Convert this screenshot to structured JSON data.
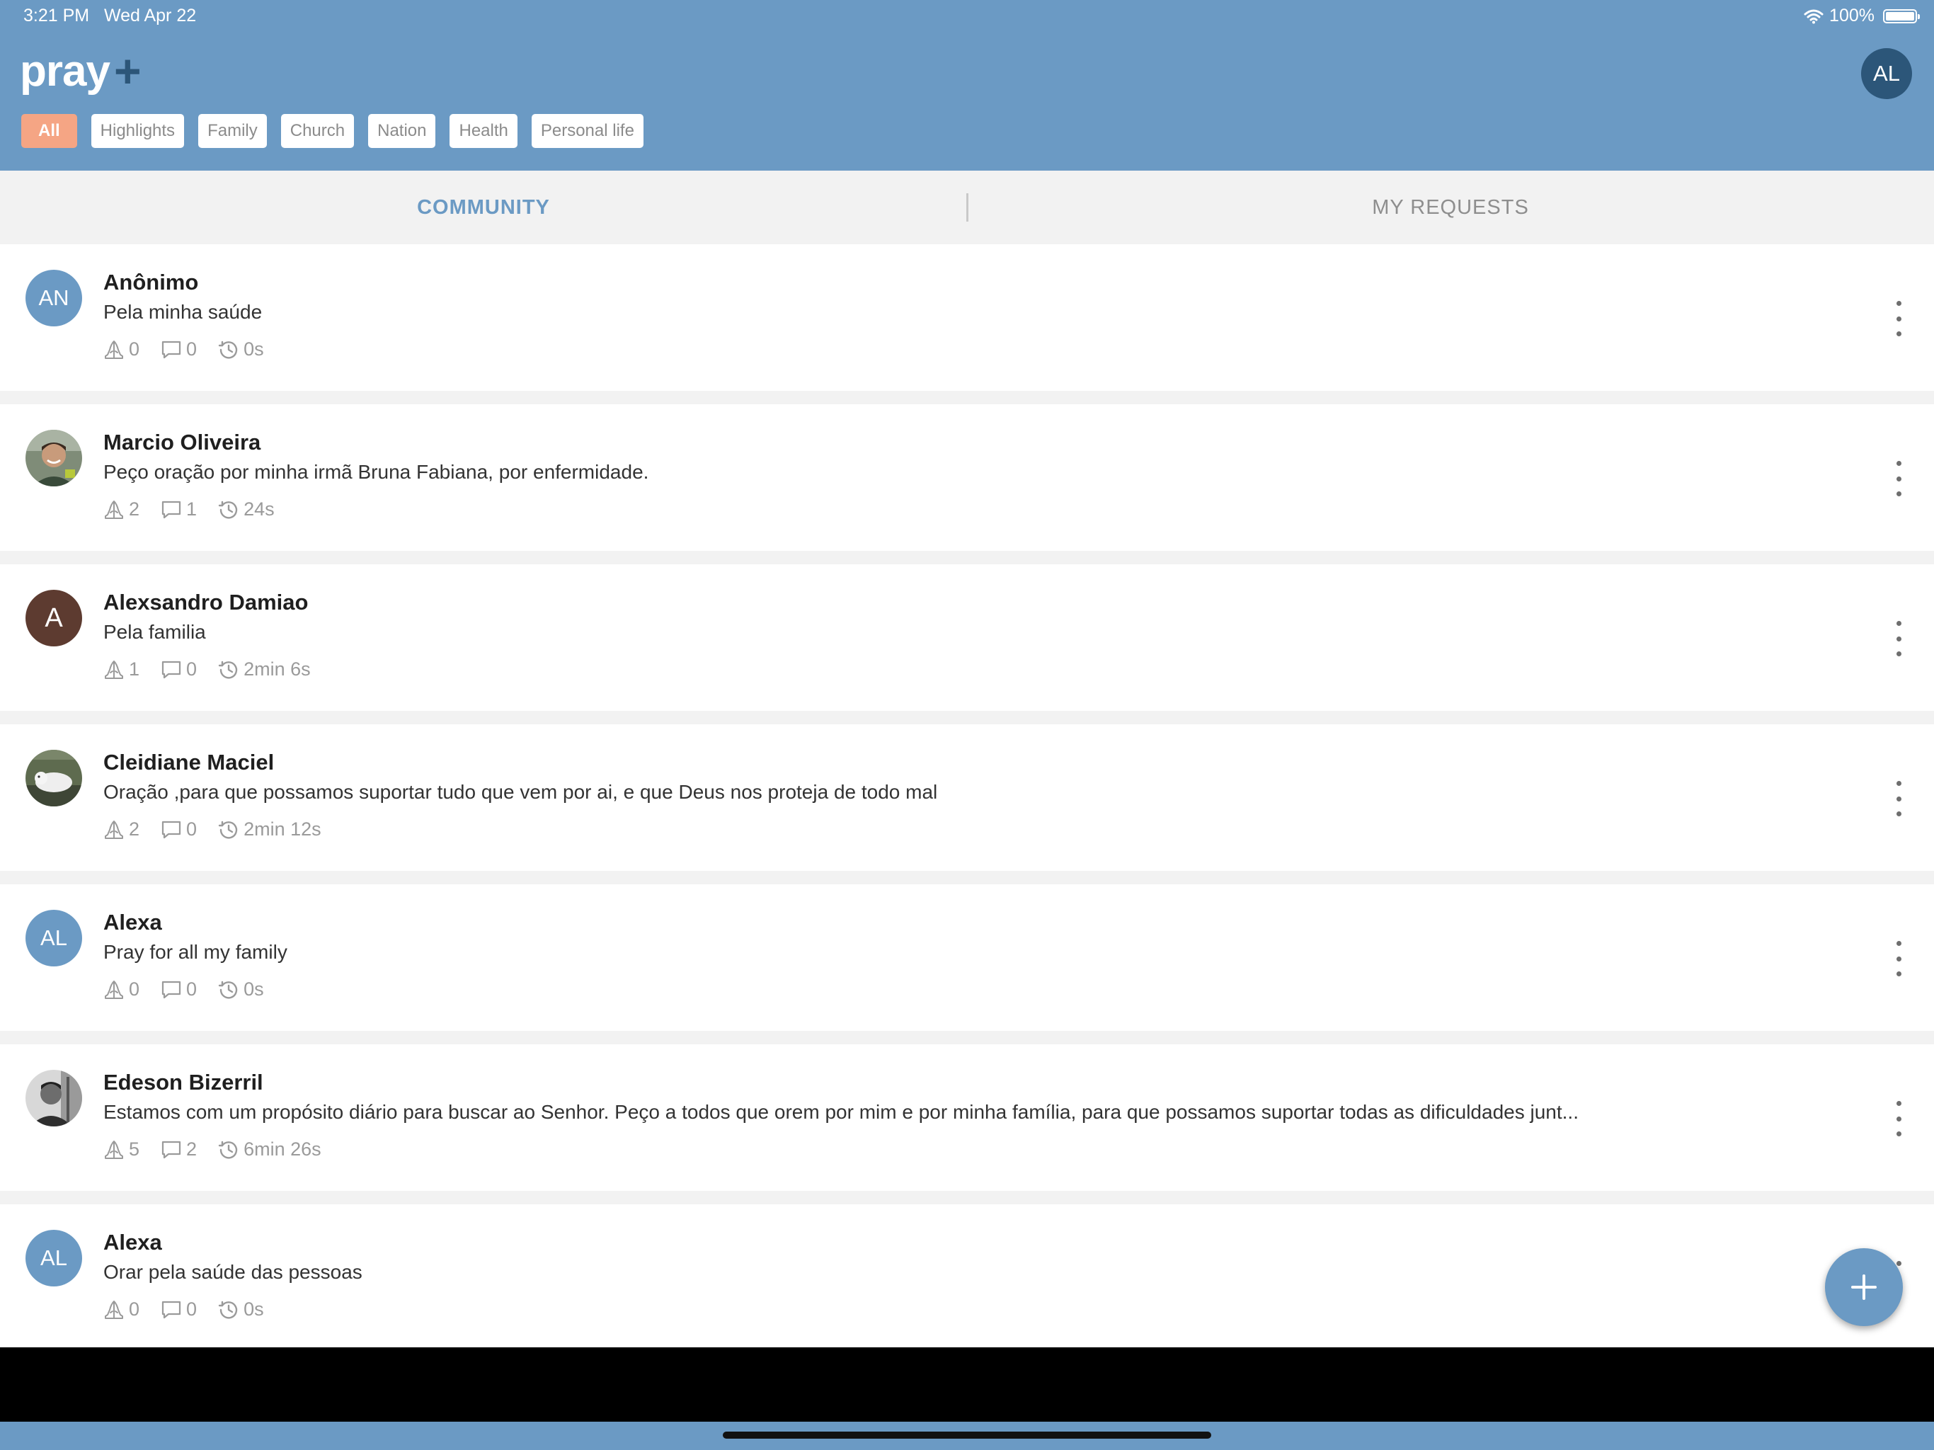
{
  "status_bar": {
    "time": "3:21 PM",
    "date": "Wed Apr 22",
    "battery": "100%"
  },
  "header": {
    "logo_text": "pray",
    "logo_plus": "+",
    "user_initials": "AL"
  },
  "filters": [
    {
      "label": "All",
      "active": true
    },
    {
      "label": "Highlights",
      "active": false
    },
    {
      "label": "Family",
      "active": false
    },
    {
      "label": "Church",
      "active": false
    },
    {
      "label": "Nation",
      "active": false
    },
    {
      "label": "Health",
      "active": false
    },
    {
      "label": "Personal life",
      "active": false
    }
  ],
  "tabs": {
    "community": "COMMUNITY",
    "my_requests": "MY REQUESTS",
    "selected": "community"
  },
  "posts": [
    {
      "name": "Anônimo",
      "initials": "AN",
      "avatar": "initials-blue",
      "text": "Pela minha saúde",
      "prayers": "0",
      "comments": "0",
      "time": "0s"
    },
    {
      "name": "Marcio Oliveira",
      "avatar": "photo-man-smiling",
      "text": "Peço oração por minha irmã Bruna Fabiana,  por enfermidade.",
      "prayers": "2",
      "comments": "1",
      "time": "24s"
    },
    {
      "name": "Alexsandro Damiao",
      "initials": "A",
      "avatar": "initials-brown",
      "text": "Pela familia",
      "prayers": "1",
      "comments": "0",
      "time": "2min 6s"
    },
    {
      "name": "Cleidiane Maciel",
      "avatar": "photo-animal",
      "text": "Oração ,para que possamos suportar tudo que vem por ai, e que Deus nos proteja de todo mal",
      "prayers": "2",
      "comments": "0",
      "time": "2min 12s"
    },
    {
      "name": "Alexa",
      "initials": "AL",
      "avatar": "initials-blue",
      "text": "Pray for all my family",
      "prayers": "0",
      "comments": "0",
      "time": "0s"
    },
    {
      "name": "Edeson Bizerril",
      "avatar": "photo-man-bw",
      "text": "Estamos com um propósito diário para buscar ao Senhor. Peço a todos que orem por mim e por minha família, para que possamos suportar todas as dificuldades junt...",
      "prayers": "5",
      "comments": "2",
      "time": "6min 26s"
    },
    {
      "name": "Alexa",
      "initials": "AL",
      "avatar": "initials-blue",
      "text": "Orar pela saúde das pessoas",
      "prayers": "0",
      "comments": "0",
      "time": "0s"
    }
  ],
  "icons": {
    "prayers": "praying-hands-icon",
    "comments": "comment-bubble-icon",
    "time": "history-clock-icon",
    "more": "more-vertical-icon",
    "add": "plus-icon",
    "wifi": "wifi-icon",
    "battery": "battery-icon"
  },
  "colors": {
    "header": "#6b9ac4",
    "accent": "#6b9ac4",
    "active_chip": "#f5a584",
    "dark_blue": "#2c5679",
    "avatar_brown": "#5d3b30"
  }
}
